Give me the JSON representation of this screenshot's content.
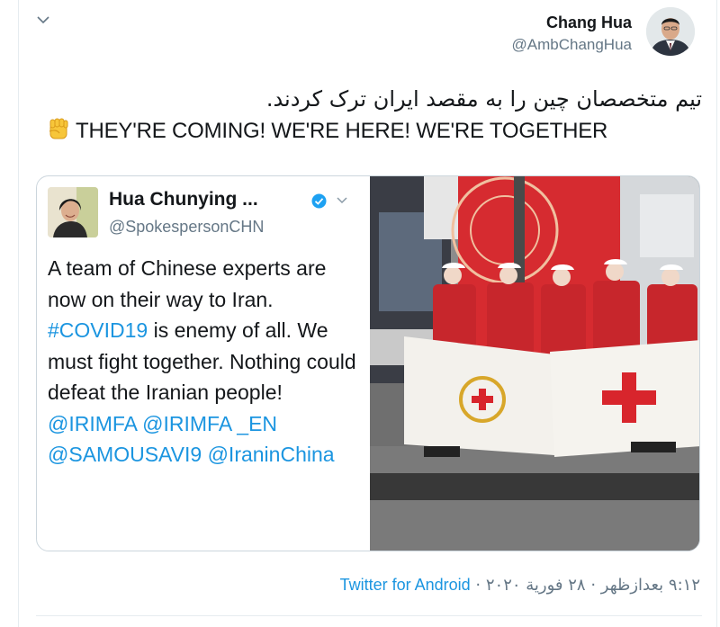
{
  "tweet": {
    "author_name": "Chang Hua",
    "author_handle": "@AmbChangHua",
    "text_persian": "تیم متخصصان چین را به مقصد ایران ترک کردند.",
    "text_english": "THEY'RE COMING! WE'RE HERE! WE'RE TOGETHER",
    "emoji_icon": "raised-fist-icon"
  },
  "quoted": {
    "author_name": "Hua Chunying ...",
    "author_handle": "@SpokespersonCHN",
    "verified": true,
    "text_1": "A team of Chinese experts are now on their way to Iran. ",
    "hashtag": "#COVID19",
    "text_2": " is enemy of all. We must fight together. Nothing could defeat the Iranian people! ",
    "mention_1": "@IRIMFA",
    "mention_2": "@IRIMFA _EN",
    "mention_3": "@SAMOUSAVI9",
    "mention_4": "@IraninChina"
  },
  "footer": {
    "time": "٩:١٢ بعدازظهر",
    "date": "٢٨ فورية ٢٠٢٠",
    "separator": "·",
    "source": "Twitter for Android"
  },
  "colors": {
    "link": "#1b95e0",
    "text": "#14171a",
    "secondary": "#657786",
    "border": "#ccd6dd"
  }
}
